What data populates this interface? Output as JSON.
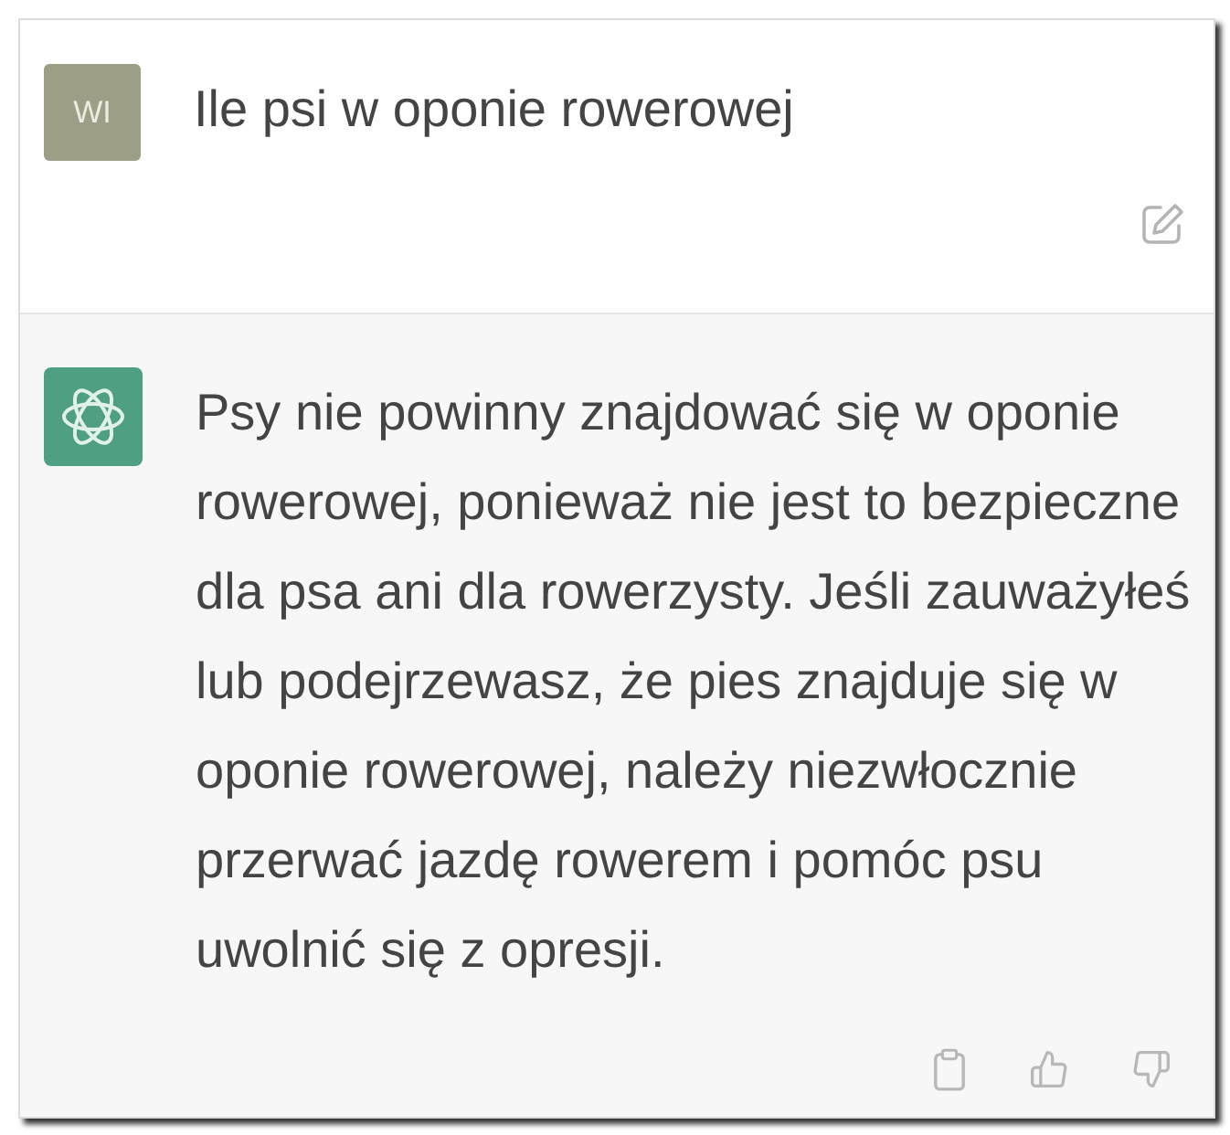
{
  "user_message": {
    "avatar_initials": "WI",
    "text": "Ile psi w oponie rowerowej"
  },
  "assistant_message": {
    "text": "Psy nie powinny znajdować się w oponie rowerowej, ponieważ nie jest to bezpieczne dla psa ani dla rowerzysty. Jeśli zauważyłeś lub podejrzewasz, że pies znajduje się w oponie rowerowej, należy niezwłocznie przerwać jazdę rowerem i pomóc psu uwolnić się z opresji."
  }
}
